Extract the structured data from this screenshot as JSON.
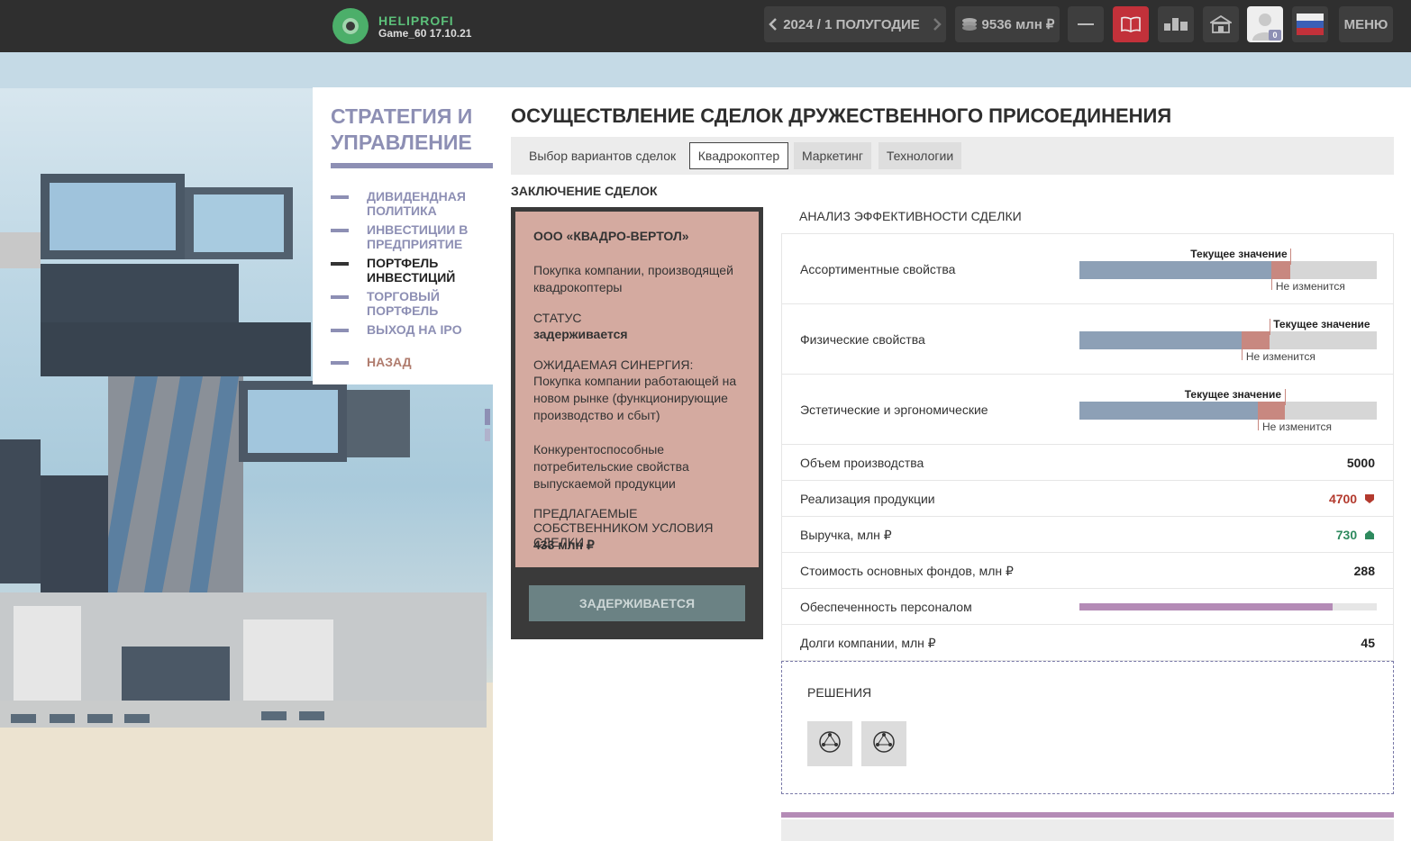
{
  "topbar": {
    "brand": "HELIPROFI",
    "game": "Game_60 17.10.21",
    "period": "2024 / 1 ПОЛУГОДИЕ",
    "money": "9536 млн ₽",
    "avatar_badge": "0",
    "menu": "МЕНЮ",
    "icons": [
      "chevron-left-icon",
      "chevron-right-icon",
      "coins-icon",
      "minus-icon",
      "book-icon",
      "chart-icon",
      "building-icon",
      "avatar",
      "flag-ru-icon"
    ]
  },
  "sidemenu": {
    "title": "СТРАТЕГИЯ И УПРАВЛЕНИЕ",
    "items": [
      {
        "label": "ДИВИДЕНДНАЯ ПОЛИТИКА"
      },
      {
        "label": "ИНВЕСТИЦИИ В ПРЕДПРИЯТИЕ"
      },
      {
        "label": "ПОРТФЕЛЬ ИНВЕСТИЦИЙ"
      },
      {
        "label": "ТОРГОВЫЙ ПОРТФЕЛЬ"
      },
      {
        "label": "ВЫХОД НА IPO"
      },
      {
        "label": "НАЗАД"
      }
    ]
  },
  "main": {
    "title": "ОСУЩЕСТВЛЕНИЕ СДЕЛОК ДРУЖЕСТВЕННОГО ПРИСОЕДИНЕНИЯ",
    "tabs_label": "Выбор вариантов сделок",
    "tabs": [
      "Квадрокоптер",
      "Маркетинг",
      "Технологии"
    ],
    "section": "ЗАКЛЮЧЕНИЕ СДЕЛОК"
  },
  "deal": {
    "company": "ООО «КВАДРО-ВЕРТОЛ»",
    "desc": "Покупка компании, производящей квадрокоптеры",
    "status_label": "СТАТУС",
    "status_value": "задерживается",
    "synergy_label": "ОЖИДАЕМАЯ СИНЕРГИЯ:",
    "synergy_text": "Покупка компании работающей на новом рынке (функционирующие производство и сбыт)",
    "synergy_text2": "Конкурентоспособные потребительские свойства выпускаемой продукции",
    "terms_label": "ПРЕДЛАГАЕМЫЕ СОБСТВЕННИКОМ УСЛОВИЯ СДЕЛКИ",
    "terms_value": "433 млн ₽",
    "button": "ЗАДЕРЖИВАЕТСЯ"
  },
  "analysis": {
    "title": "АНАЛИЗ ЭФФЕКТИВНОСТИ СДЕЛКИ",
    "current_label": "Текущее значение",
    "nochange_label": "Не изменится",
    "bars": [
      {
        "label": "Ассортиментные свойства",
        "base": 0.645,
        "current": 0.71
      },
      {
        "label": "Физические свойства",
        "base": 0.545,
        "current": 0.64
      },
      {
        "label": "Эстетические и эргономические",
        "base": 0.6,
        "current": 0.69
      }
    ],
    "values": [
      {
        "label": "Объем производства",
        "value": "5000"
      },
      {
        "label": "Реализация продукции",
        "value": "4700"
      },
      {
        "label": "Выручка, млн ₽",
        "value": "730"
      },
      {
        "label": "Стоимость основных фондов, млн ₽",
        "value": "288"
      }
    ],
    "staff": {
      "label": "Обеспеченность персоналом",
      "level": 0.85
    },
    "debt": {
      "label": "Долги компании, млн ₽",
      "value": "45"
    },
    "colors": {
      "down": "#b33a2e",
      "up": "#2e8a5e",
      "bar": "#8da0b6",
      "delta": "#c88880",
      "staff": "#b48bb6"
    }
  },
  "decisions": {
    "title": "РЕШЕНИЯ",
    "icons": [
      "network-icon",
      "network-icon"
    ]
  }
}
